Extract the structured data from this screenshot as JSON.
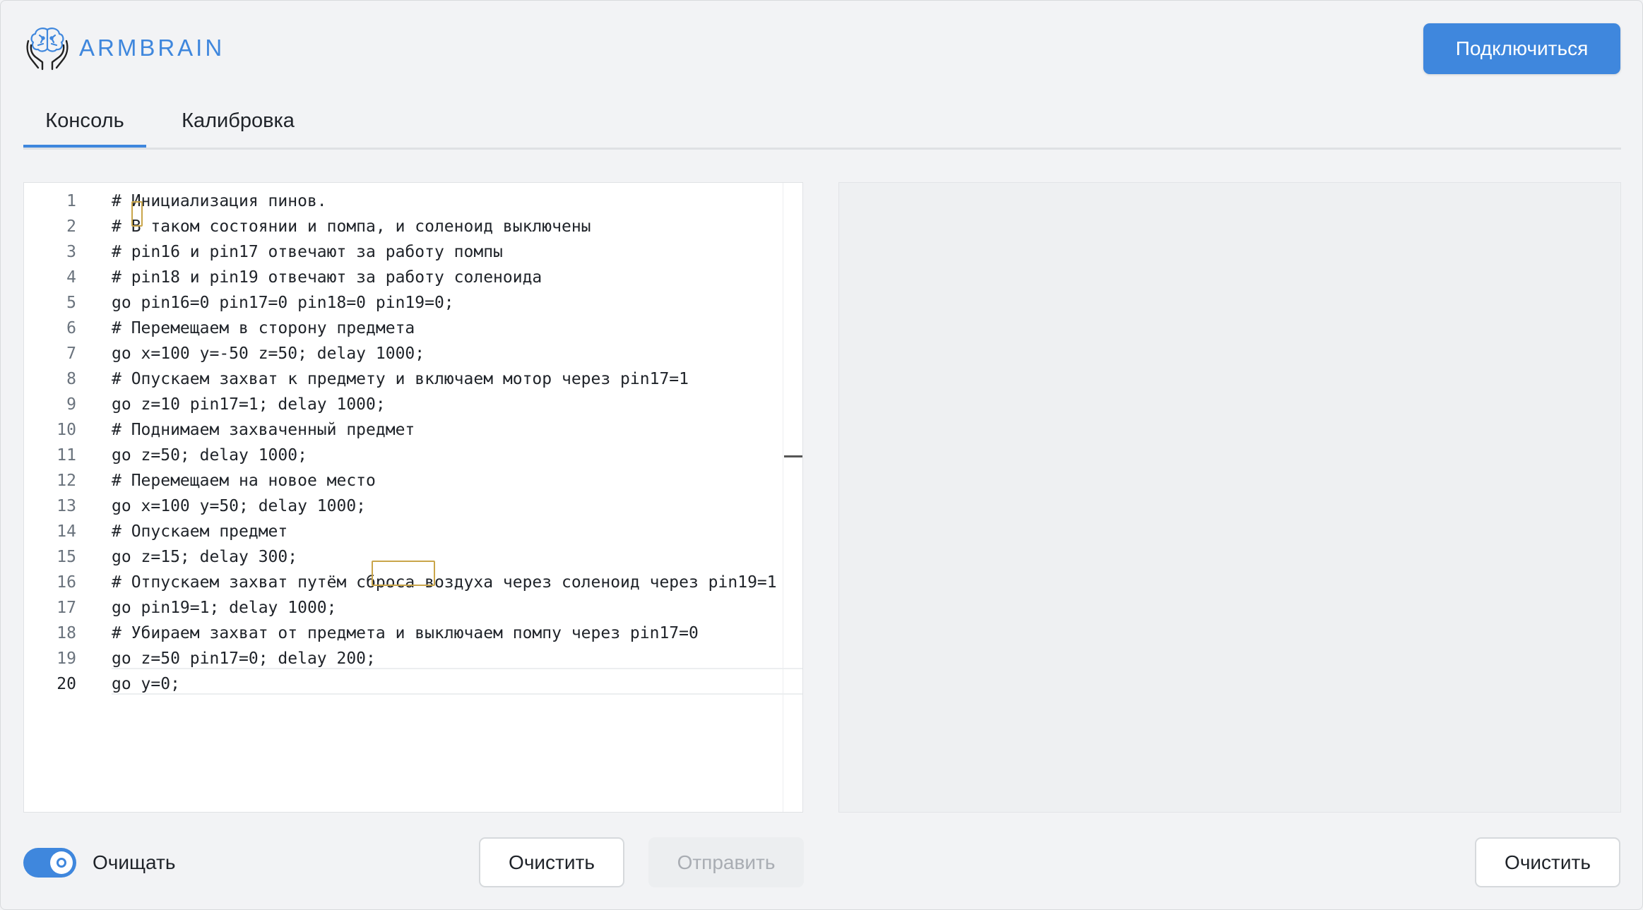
{
  "app": {
    "brand": "ARMBRAIN",
    "connect_label": "Подключиться"
  },
  "tabs": [
    {
      "label": "Консоль",
      "active": true
    },
    {
      "label": "Калибровка",
      "active": false
    }
  ],
  "editor": {
    "lines": [
      {
        "num": "1",
        "text": "# Инициализация пинов."
      },
      {
        "num": "2",
        "text": "# В таком состоянии и помпа, и соленоид выключены"
      },
      {
        "num": "3",
        "text": "# pin16 и pin17 отвечают за работу помпы"
      },
      {
        "num": "4",
        "text": "# pin18 и pin19 отвечают за работу соленоида"
      },
      {
        "num": "5",
        "text": "go pin16=0 pin17=0 pin18=0 pin19=0;"
      },
      {
        "num": "6",
        "text": "# Перемещаем в сторону предмета"
      },
      {
        "num": "7",
        "text": "go x=100 y=-50 z=50; delay 1000;"
      },
      {
        "num": "8",
        "text": "# Опускаем захват к предмету и включаем мотор через pin17=1"
      },
      {
        "num": "9",
        "text": "go z=10 pin17=1; delay 1000;"
      },
      {
        "num": "10",
        "text": "# Поднимаем захваченный предмет"
      },
      {
        "num": "11",
        "text": "go z=50; delay 1000;"
      },
      {
        "num": "12",
        "text": "# Перемещаем на новое место"
      },
      {
        "num": "13",
        "text": "go x=100 y=50; delay 1000;"
      },
      {
        "num": "14",
        "text": "# Опускаем предмет"
      },
      {
        "num": "15",
        "text": "go z=15; delay 300;"
      },
      {
        "num": "16",
        "text": "# Отпускаем захват путём сброса воздуха через соленоид через pin19=1"
      },
      {
        "num": "17",
        "text": "go pin19=1; delay 1000;"
      },
      {
        "num": "18",
        "text": "# Убираем захват от предмета и выключаем помпу через pin17=0"
      },
      {
        "num": "19",
        "text": "go z=50 pin17=0; delay 200;"
      },
      {
        "num": "20",
        "text": "go y=0;"
      }
    ]
  },
  "controls": {
    "toggle_label": "Очищать",
    "toggle_on": true,
    "clear_label": "Очистить",
    "send_label": "Отправить",
    "clear_output_label": "Очистить"
  },
  "colors": {
    "accent": "#3f87dd"
  }
}
